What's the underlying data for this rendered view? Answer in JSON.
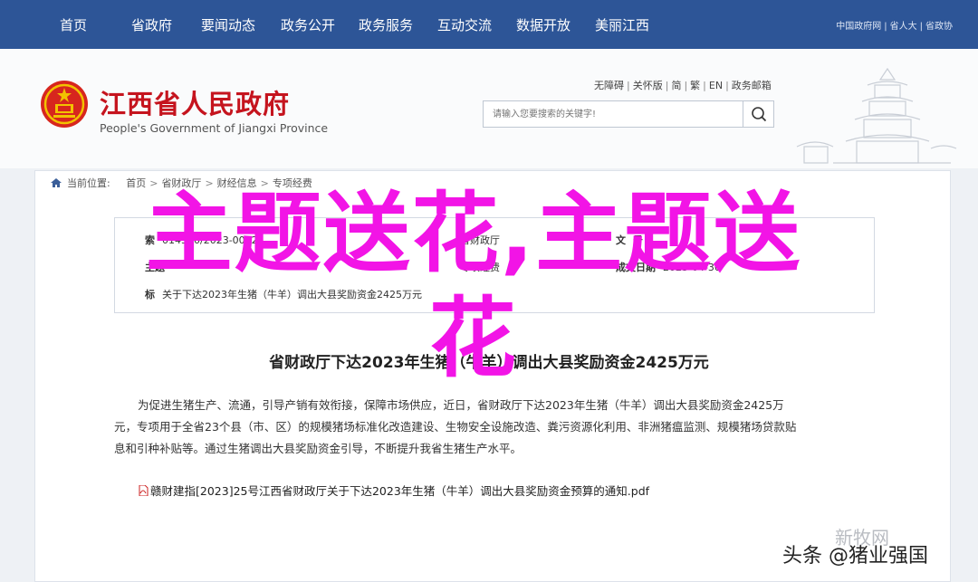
{
  "nav": {
    "items": [
      "首页",
      "省政府",
      "要闻动态",
      "政务公开",
      "政务服务",
      "互动交流",
      "数据开放",
      "美丽江西"
    ],
    "links": [
      "中国政府网",
      "省人大",
      "省政协"
    ]
  },
  "header": {
    "title": "江西省人民政府",
    "subtitle": "People's Government of Jiangxi Province",
    "access_links": [
      "无障碍",
      "关怀版",
      "简",
      "繁",
      "EN",
      "政务邮箱"
    ],
    "search": {
      "placeholder": "请输入您要搜索的关键字!",
      "button_icon": "search-icon"
    }
  },
  "breadcrumb": {
    "label": "当前位置:",
    "items": [
      "首页",
      "省财政厅",
      "财经信息",
      "专项经费"
    ]
  },
  "infobox": {
    "rows": [
      {
        "key": "索",
        "value": "014590/2023-0032",
        "key2": "省财政厅",
        "key3": "文",
        "value3": "号"
      },
      {
        "key": "主题",
        "value": "",
        "key2": "专项经费",
        "key3": "成文日期",
        "value3": "2023-04-30"
      },
      {
        "key": "标",
        "value": "关于下达2023年生猪（牛羊）调出大县奖励资金2425万元"
      }
    ]
  },
  "article": {
    "title": "省财政厅下达2023年生猪（牛羊）调出大县奖励资金2425万元",
    "lines": [
      "为促进生猪生产、流通，引导产销有效衔接，保障市场供应，近日，省财政厅下达2023年生猪（牛羊）调出大县奖励资金2425万",
      "元，专项用于全省23个县（市、区）的规模猪场标准化改造建设、生物安全设施改造、粪污资源化利用、非洲猪瘟监测、规模猪场贷款贴",
      "息和引种补贴等。通过生猪调出大县奖励资金引导，不断提升我省生猪生产水平。"
    ],
    "attachment": "赣财建指[2023]25号江西省财政厅关于下达2023年生猪（牛羊）调出大县奖励资金预算的通知.pdf"
  },
  "overlay": {
    "line1": "主题送花,主题送",
    "line2": "花"
  },
  "watermarks": {
    "faded": "新牧网",
    "main": "头条 @猪业强国"
  },
  "colors": {
    "nav_bg": "#2d5597",
    "title_red": "#c5141e",
    "overlay": "#f214e6"
  }
}
